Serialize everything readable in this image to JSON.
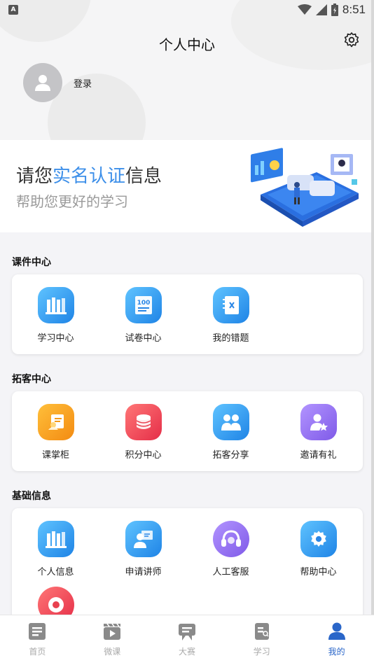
{
  "status_bar": {
    "time": "8:51",
    "app_badge": "A"
  },
  "header": {
    "title": "个人中心",
    "login_label": "登录"
  },
  "banner": {
    "title_prefix": "请您",
    "title_highlight": "实名认证",
    "title_suffix": "信息",
    "subtitle": "帮助您更好的学习",
    "accent_color": "#3d8fe9"
  },
  "sections": [
    {
      "title": "课件中心",
      "items": [
        {
          "label": "学习中心",
          "icon": "books-icon",
          "color": "#2f9df0"
        },
        {
          "label": "试卷中心",
          "icon": "exam-100-icon",
          "color": "#2f9df0"
        },
        {
          "label": "我的错题",
          "icon": "notebook-x-icon",
          "color": "#2f9df0"
        }
      ]
    },
    {
      "title": "拓客中心",
      "items": [
        {
          "label": "课掌柜",
          "icon": "shopkeeper-icon",
          "color": "#f7a01a"
        },
        {
          "label": "积分中心",
          "icon": "coins-icon",
          "color": "#f2495a"
        },
        {
          "label": "拓客分享",
          "icon": "people-share-icon",
          "color": "#2f9df0"
        },
        {
          "label": "邀请有礼",
          "icon": "invite-user-icon",
          "color": "#8c6df2"
        }
      ]
    },
    {
      "title": "基础信息",
      "items": [
        {
          "label": "个人信息",
          "icon": "books-icon",
          "color": "#2f9df0"
        },
        {
          "label": "申请讲师",
          "icon": "lecturer-icon",
          "color": "#2f9df0"
        },
        {
          "label": "人工客服",
          "icon": "headset-icon",
          "color": "#8c6df2"
        },
        {
          "label": "帮助中心",
          "icon": "gear-icon",
          "color": "#2f9df0"
        },
        {
          "label": "",
          "icon": "record-icon",
          "color": "#f2495a"
        }
      ]
    }
  ],
  "tabbar": [
    {
      "label": "首页",
      "icon": "home-icon",
      "active": false
    },
    {
      "label": "微课",
      "icon": "video-icon",
      "active": false
    },
    {
      "label": "大赛",
      "icon": "contest-icon",
      "active": false
    },
    {
      "label": "学习",
      "icon": "study-icon",
      "active": false
    },
    {
      "label": "我的",
      "icon": "profile-icon",
      "active": true
    }
  ]
}
